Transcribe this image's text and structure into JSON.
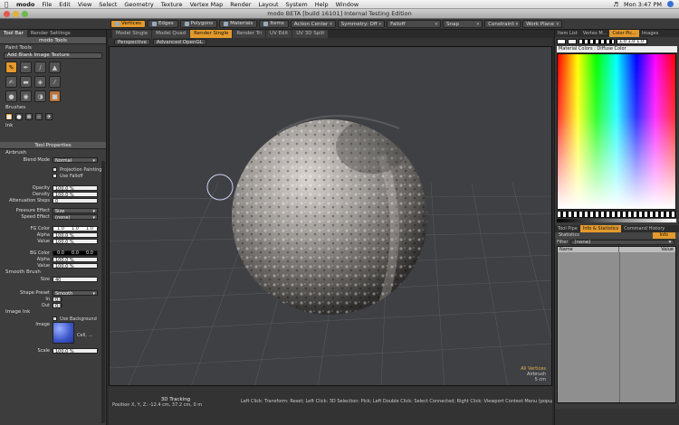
{
  "menubar": {
    "app": "modo",
    "items": [
      "File",
      "Edit",
      "View",
      "Select",
      "Geometry",
      "Texture",
      "Vertex Map",
      "Render",
      "Layout",
      "System",
      "Help",
      "Window"
    ],
    "clock": "Mon 3:47 PM"
  },
  "window": {
    "title": "modo BETA [build 16101] Internal Testing Edition"
  },
  "toolbar": {
    "modes": [
      "Vertices",
      "Edges",
      "Polygons",
      "Materials",
      "Items"
    ],
    "dropdowns": [
      "Action Center",
      "Symmetry: Off",
      "Falloff",
      "Snap",
      "Constraint",
      "Work Plane"
    ]
  },
  "left": {
    "tabs": [
      "Tool Bar",
      "Render Settings"
    ],
    "header": "modo Tools",
    "paint_tools": "Paint Tools",
    "add_image": "Add Blank Image Texture",
    "brushes": "Brushes",
    "ink": "Ink",
    "tool_props": "Tool Properties",
    "airbrush": "Airbrush",
    "blend_mode": {
      "label": "Blend Mode",
      "value": "Normal"
    },
    "projection": "Projection Painting",
    "use_falloff": "Use Falloff",
    "opacity": {
      "label": "Opacity",
      "value": "100.0 %"
    },
    "density": {
      "label": "Density",
      "value": "100.0 %"
    },
    "atten": {
      "label": "Attenuation Steps",
      "value": "0"
    },
    "pressure": {
      "label": "Pressure Effect",
      "value": "Size"
    },
    "speed": {
      "label": "Speed Effect",
      "value": "(none)"
    },
    "fg": {
      "label": "FG Color",
      "r": "1.0",
      "g": "1.0",
      "b": "1.0"
    },
    "fg_alpha": {
      "label": "Alpha",
      "value": "100.0 %"
    },
    "fg_value": {
      "label": "Value",
      "value": "100.0 %"
    },
    "bg": {
      "label": "BG Color",
      "r": "0.0",
      "g": "0.0",
      "b": "0.0"
    },
    "bg_alpha": {
      "label": "Alpha",
      "value": "100.0 %"
    },
    "bg_value": {
      "label": "Value",
      "value": "100.0 %"
    },
    "smooth": "Smooth Brush",
    "size": {
      "label": "Size",
      "value": "40"
    },
    "shape": {
      "label": "Shape Preset",
      "value": "Smooth"
    },
    "in": {
      "label": "In",
      "value": "0.0"
    },
    "out": {
      "label": "Out",
      "value": "0.0"
    },
    "image_ink": "Image Ink",
    "use_bg": "Use Background",
    "image": {
      "label": "Image",
      "value": "Cell, ..."
    },
    "scale": {
      "label": "Scale",
      "value": "100.0 %"
    }
  },
  "viewport": {
    "tabs": [
      "Model Single",
      "Model Quad",
      "Render Single",
      "Render Tri",
      "UV Edit",
      "UV 3D Split"
    ],
    "active_tab": "Render Single",
    "view": "Perspective",
    "shading": "Advanced OpenGL",
    "info": {
      "sel": "All Vertices",
      "tool": "Airbrush",
      "dist": "5 cm"
    },
    "tracking": "3D Tracking",
    "position": "Position X, Y, Z:  -12.4 cm, 37.2 cm, 0 m",
    "hint": "Left Click: Transform: Reset;  Left Click: 3D Selection: Pick;  Left Double Click: Select Connected;  Right Click: Viewport Context Menu (popup menu);  Right Double..."
  },
  "right": {
    "tabs": [
      "Item List",
      "Vertex M...",
      "Color Pic...",
      "Images"
    ],
    "rgb": "1.0  1.0  1.0",
    "mat_label": "Material Colors : Diffuse Color",
    "tabs2": [
      "Tool Pipe",
      "Info & Statistics",
      "Command History"
    ],
    "stats_label": "Statistics",
    "stats_badge": "Info",
    "filter_label": "Filter",
    "filter_value": "(none)",
    "col_name": "Name",
    "col_value": "Value"
  },
  "colors": {
    "accent": "#e39a2b"
  }
}
